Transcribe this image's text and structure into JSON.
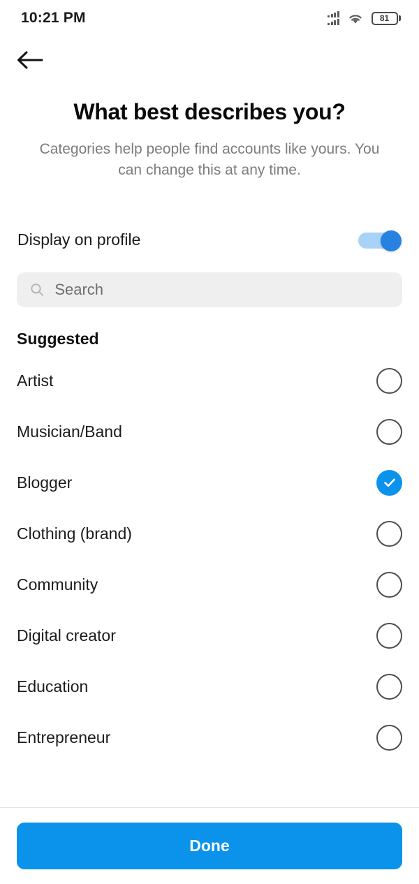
{
  "status_bar": {
    "time": "10:21 PM",
    "signal_icon": "signal-bars-dual-sim-icon",
    "wifi_icon": "wifi-icon",
    "battery_icon": "battery-icon",
    "battery_level": "81"
  },
  "nav": {
    "back_icon": "back-arrow-icon"
  },
  "header": {
    "title": "What best describes you?",
    "subtitle": "Categories help people find accounts like yours. You can change this at any time."
  },
  "display_toggle": {
    "label": "Display on profile",
    "state": "on"
  },
  "search": {
    "icon": "search-icon",
    "placeholder": "Search",
    "value": ""
  },
  "suggested": {
    "section_label": "Suggested",
    "items": [
      {
        "label": "Artist",
        "selected": false
      },
      {
        "label": "Musician/Band",
        "selected": false
      },
      {
        "label": "Blogger",
        "selected": true
      },
      {
        "label": "Clothing (brand)",
        "selected": false
      },
      {
        "label": "Community",
        "selected": false
      },
      {
        "label": "Digital creator",
        "selected": false
      },
      {
        "label": "Education",
        "selected": false
      },
      {
        "label": "Entrepreneur",
        "selected": false
      }
    ]
  },
  "footer": {
    "done_label": "Done"
  },
  "colors": {
    "accent": "#0b93ec",
    "toggle_track": "#a8d3f7",
    "toggle_thumb": "#2681e0",
    "search_bg": "#efefef",
    "subtitle_text": "#7c7c7c",
    "radio_border": "#4e4e4e"
  }
}
